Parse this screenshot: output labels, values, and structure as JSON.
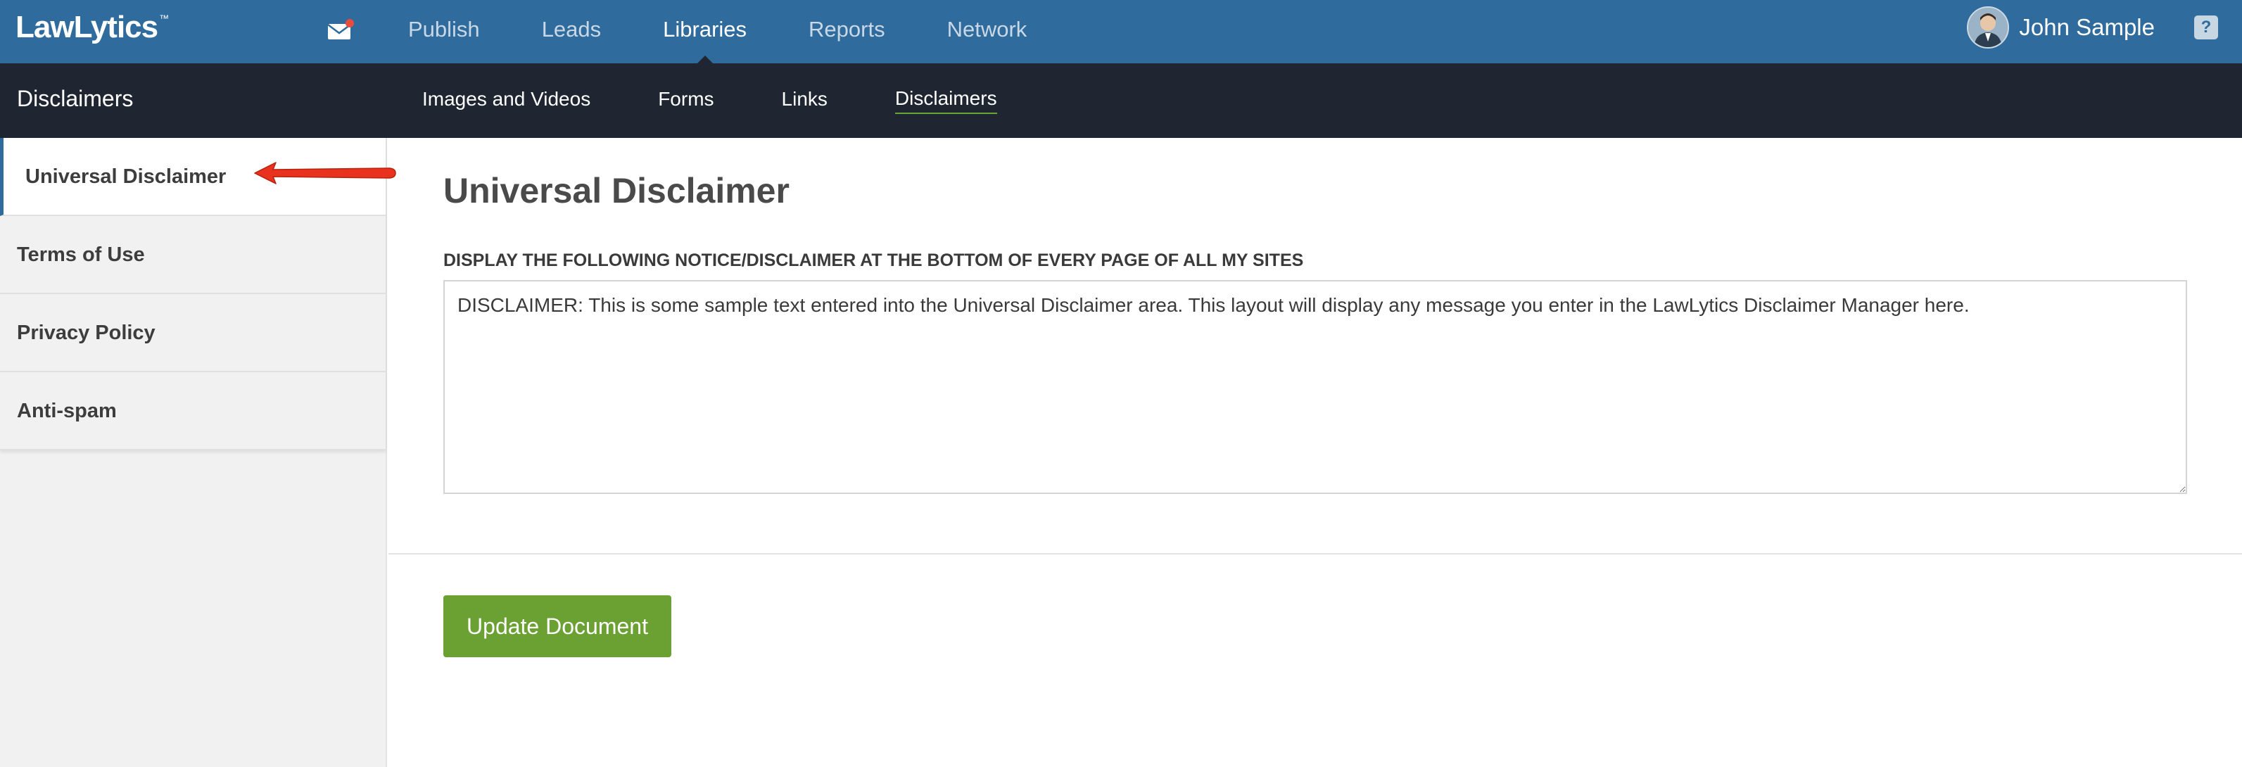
{
  "brand": {
    "logo_text": "LawLytics",
    "trademark": "™"
  },
  "topnav": {
    "items": [
      {
        "label": "Publish"
      },
      {
        "label": "Leads"
      },
      {
        "label": "Libraries",
        "active": true
      },
      {
        "label": "Reports"
      },
      {
        "label": "Network"
      }
    ],
    "mail_icon": "envelope-icon",
    "notification_color": "#e74c3c"
  },
  "user": {
    "name": "John Sample",
    "help_label": "?"
  },
  "subnav": {
    "section_title": "Disclaimers",
    "items": [
      {
        "label": "Images and Videos"
      },
      {
        "label": "Forms"
      },
      {
        "label": "Links"
      },
      {
        "label": "Disclaimers",
        "active": true
      }
    ]
  },
  "sidebar": {
    "items": [
      {
        "label": "Universal Disclaimer",
        "active": true
      },
      {
        "label": "Terms of Use"
      },
      {
        "label": "Privacy Policy"
      },
      {
        "label": "Anti-spam"
      }
    ]
  },
  "main": {
    "heading": "Universal Disclaimer",
    "field_label": "DISPLAY THE FOLLOWING NOTICE/DISCLAIMER AT THE BOTTOM OF EVERY PAGE OF ALL MY SITES",
    "disclaimer_text": "DISCLAIMER: This is some sample text entered into the Universal Disclaimer area. This layout will display any message you enter in the LawLytics Disclaimer Manager here.",
    "update_button": "Update Document"
  },
  "colors": {
    "topbar": "#2f6b9c",
    "subbar": "#1f2632",
    "accent_green": "#6aa132",
    "annotation_arrow": "#e8321e"
  }
}
